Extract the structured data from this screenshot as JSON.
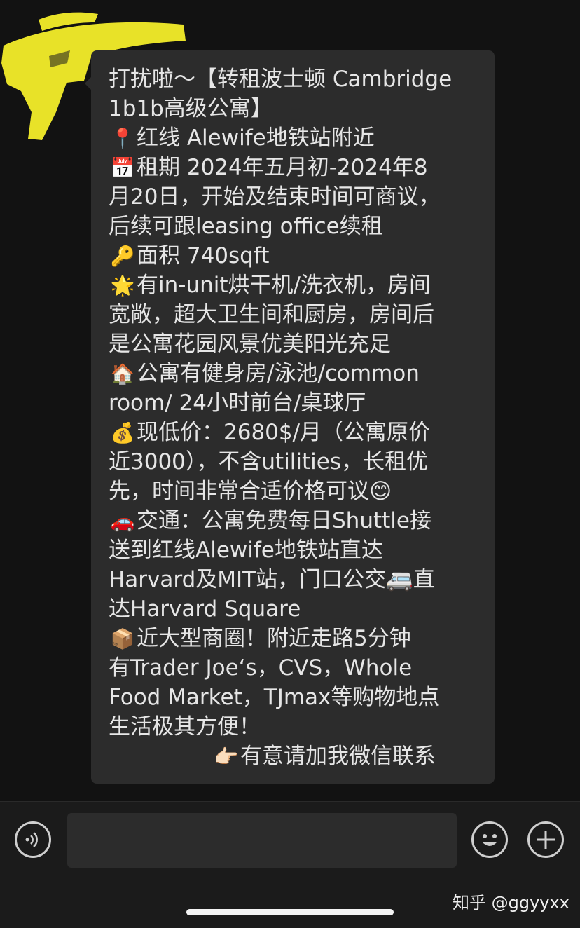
{
  "message": {
    "lines": [
      {
        "emoji": "",
        "text": "打扰啦～【转租波士顿 Cambridge"
      },
      {
        "emoji": "",
        "text": "1b1b高级公寓】"
      },
      {
        "emoji": "📍",
        "text": "红线 Alewife地铁站附近"
      },
      {
        "emoji": "📅",
        "text": "租期 2024年五月初-2024年8"
      },
      {
        "emoji": "",
        "text": "月20日，开始及结束时间可商议，"
      },
      {
        "emoji": "",
        "text": "后续可跟leasing office续租"
      },
      {
        "emoji": "🔑",
        "text": "面积 740sqft"
      },
      {
        "emoji": "🌟",
        "text": "有in-unit烘干机/洗衣机，房间"
      },
      {
        "emoji": "",
        "text": "宽敞，超大卫生间和厨房，房间后"
      },
      {
        "emoji": "",
        "text": "是公寓花园风景优美阳光充足"
      },
      {
        "emoji": "🏠",
        "text": "公寓有健身房/泳池/common"
      },
      {
        "emoji": "",
        "text": "room/ 24小时前台/桌球厅"
      },
      {
        "emoji": "💰",
        "text": "现低价：2680$/月（公寓原价"
      },
      {
        "emoji": "",
        "text": "近3000），不含utilities，长租优"
      },
      {
        "emoji": "",
        "text": "先，时间非常合适价格可议😊"
      },
      {
        "emoji": "🚗",
        "text": "交通：公寓免费每日Shuttle接"
      },
      {
        "emoji": "",
        "text": "送到红线Alewife地铁站直达"
      },
      {
        "emoji": "",
        "text": "Harvard及MIT站，门口公交🚐直"
      },
      {
        "emoji": "",
        "text": "达Harvard Square"
      },
      {
        "emoji": "📦",
        "text": "近大型商圈！附近走路5分钟"
      },
      {
        "emoji": "",
        "text": "有Trader Joe‘s，CVS，Whole"
      },
      {
        "emoji": "",
        "text": "Food Market，TJmax等购物地点"
      },
      {
        "emoji": "",
        "text": "生活极其方便！"
      }
    ],
    "signoff_emoji": "👉🏻",
    "signoff_text": "有意请加我微信联系"
  },
  "input": {
    "value": ""
  },
  "icons": {
    "voice": "voice-icon",
    "emoji": "smiley-icon",
    "more": "plus-icon"
  },
  "watermark": "知乎 @ggyyxx",
  "colors": {
    "bubble": "#2c2c2c",
    "background": "#121212",
    "highlight": "#f4ee2a",
    "text": "#e6e6e6"
  }
}
